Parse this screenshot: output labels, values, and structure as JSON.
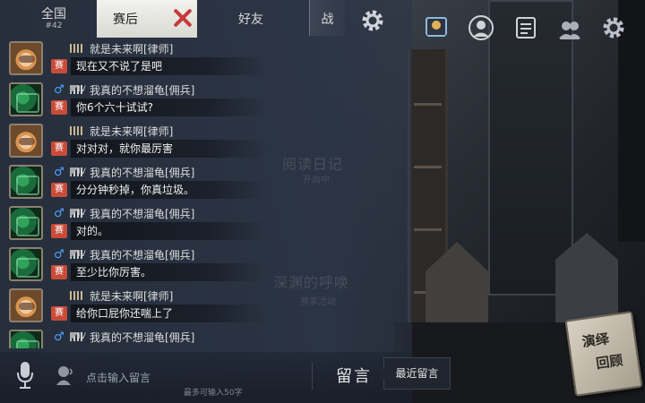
{
  "tabs": {
    "all_label": "全国",
    "all_count": "#42",
    "post_match_label": "赛后",
    "friends_label": "好友",
    "battle_label": "战"
  },
  "background_text": {
    "reading_diary": "阅读日记",
    "reading_sub": "开启中",
    "abyss_call": "深渊的呼唤",
    "abyss_sub": "赛事活动"
  },
  "senders": {
    "lawyer": "就是未来啊[律师]",
    "merc": "我真的不想溜龟[佣兵]"
  },
  "rank_labels": {
    "merc": "IV"
  },
  "match_tag": "赛",
  "messages": [
    {
      "type": "lawyer",
      "text": "现在又不说了是吧"
    },
    {
      "type": "merc",
      "text": "你6个六十试试?"
    },
    {
      "type": "lawyer",
      "text": "对对对，就你最厉害"
    },
    {
      "type": "merc",
      "text": "分分钟秒掉，你真垃圾。"
    },
    {
      "type": "merc",
      "text": "对的。"
    },
    {
      "type": "merc",
      "text": "至少比你厉害。"
    },
    {
      "type": "lawyer",
      "text": "给你口屁你还喘上了"
    },
    {
      "type": "merc",
      "text": ""
    }
  ],
  "input": {
    "placeholder": "点击输入留言",
    "limit_hint": "最多可输入50字"
  },
  "actions": {
    "leave_message": "留言",
    "recent_messages": "最近留言"
  },
  "replay_card": {
    "line1": "演绎",
    "line2": "回顾"
  },
  "colors": {
    "tag_red": "#c84b3a",
    "gender_blue": "#4fa3ff",
    "close_red": "#c63a3a"
  },
  "icons": [
    "settings-gear-icon",
    "badge-icon",
    "profile-icon",
    "notes-icon",
    "friends-icon",
    "settings-icon"
  ]
}
